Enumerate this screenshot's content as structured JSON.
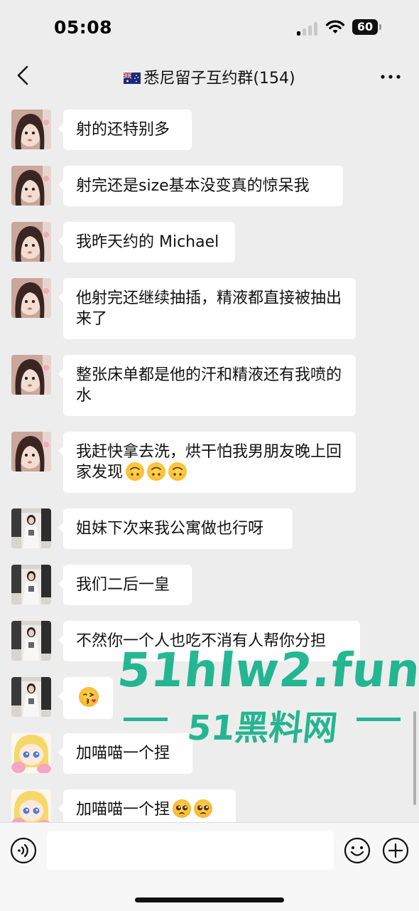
{
  "status_bar": {
    "time": "05:08",
    "battery": "60"
  },
  "nav": {
    "back_icon": "chevron-left-icon",
    "flag_icon": "australia-flag-icon",
    "title": "悉尼留子互约群(154)",
    "more_icon": "more-dots-icon"
  },
  "messages": [
    {
      "avatar": "avatar-a",
      "text": "射的还特别多"
    },
    {
      "avatar": "avatar-a",
      "text": "射完还是size基本没变真的惊呆我"
    },
    {
      "avatar": "avatar-a",
      "text": "我昨天约的 Michael"
    },
    {
      "avatar": "avatar-a",
      "text": "他射完还继续抽插，精液都直接被抽出来了"
    },
    {
      "avatar": "avatar-a",
      "text": "整张床单都是他的汗和精液还有我喷的水"
    },
    {
      "avatar": "avatar-a",
      "text": "我赶快拿去洗，烘干怕我男朋友晚上回家发现",
      "emojis": [
        "upside-down-face-icon",
        "upside-down-face-icon",
        "upside-down-face-icon"
      ]
    },
    {
      "avatar": "avatar-b",
      "text": "姐妹下次来我公寓做也行呀"
    },
    {
      "avatar": "avatar-b",
      "text": "我们二后一皇"
    },
    {
      "avatar": "avatar-b",
      "text": "不然你一个人也吃不消有人帮你分担"
    },
    {
      "avatar": "avatar-b",
      "text": "",
      "emojis": [
        "kissing-heart-face-icon"
      ]
    },
    {
      "avatar": "avatar-c",
      "text": "加喵喵一个捏"
    },
    {
      "avatar": "avatar-c",
      "text": "加喵喵一个捏",
      "emojis": [
        "pleading-face-icon",
        "pleading-face-icon"
      ]
    }
  ],
  "watermark": {
    "main": "51hlw2.fun",
    "sub": "51黑料网"
  },
  "input_bar": {
    "voice_icon": "voice-icon",
    "input_value": "",
    "emoji_icon": "smiley-icon",
    "add_icon": "plus-circle-icon"
  },
  "colors": {
    "background": "#ededed",
    "bubble": "#ffffff",
    "watermark": "#00aa80"
  }
}
